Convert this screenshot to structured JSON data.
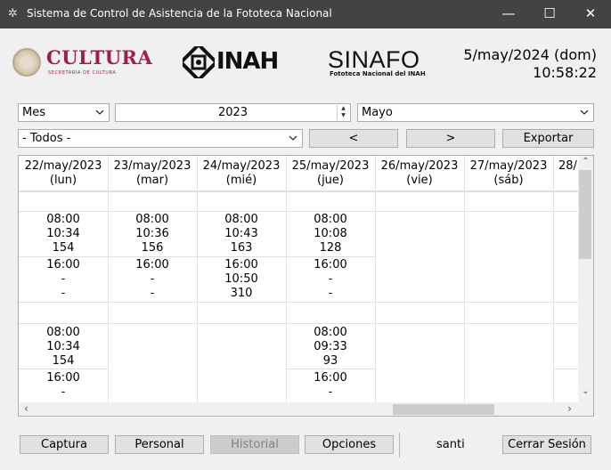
{
  "window": {
    "title": "Sistema de Control de Asistencia de la Fototeca Nacional",
    "minimize": "—",
    "maximize": "☐",
    "close": "✕"
  },
  "logos": {
    "cultura": "CULTURA",
    "cultura_sub": "SECRETARÍA DE CULTURA",
    "inah": "INAH",
    "sinafo": "SINAFO",
    "sinafo_sub": "Fototeca Nacional del INAH"
  },
  "datetime": {
    "date": "5/may/2024 (dom)",
    "time": "10:58:22"
  },
  "filters": {
    "period": "Mes",
    "year": "2023",
    "month": "Mayo",
    "group": "- Todos -",
    "prev": "<",
    "next": ">",
    "export": "Exportar"
  },
  "days": [
    {
      "date": "22/may/2023",
      "dow": "(lun)"
    },
    {
      "date": "23/may/2023",
      "dow": "(mar)"
    },
    {
      "date": "24/may/2023",
      "dow": "(mié)"
    },
    {
      "date": "25/may/2023",
      "dow": "(jue)"
    },
    {
      "date": "26/may/2023",
      "dow": "(vie)"
    },
    {
      "date": "27/may/2023",
      "dow": "(sáb)"
    },
    {
      "date": "28/",
      "dow": ""
    }
  ],
  "rows": {
    "row1_in": [
      [
        "08:00",
        "10:34",
        "154"
      ],
      [
        "08:00",
        "10:36",
        "156"
      ],
      [
        "08:00",
        "10:43",
        "163"
      ],
      [
        "08:00",
        "10:08",
        "128"
      ]
    ],
    "row1_out": [
      [
        "16:00",
        "-",
        "-"
      ],
      [
        "16:00",
        "-",
        "-"
      ],
      [
        "16:00",
        "10:50",
        "310"
      ],
      [
        "16:00",
        "-",
        "-"
      ]
    ],
    "row2_in": [
      [
        "08:00",
        "10:34",
        "154"
      ],
      [
        "08:00",
        "09:33",
        "93"
      ]
    ],
    "row2_out": [
      [
        "16:00",
        "-"
      ],
      [
        "16:00",
        "-"
      ]
    ]
  },
  "footer": {
    "captura": "Captura",
    "personal": "Personal",
    "historial": "Historial",
    "opciones": "Opciones",
    "user": "santi",
    "logout": "Cerrar Sesión"
  }
}
